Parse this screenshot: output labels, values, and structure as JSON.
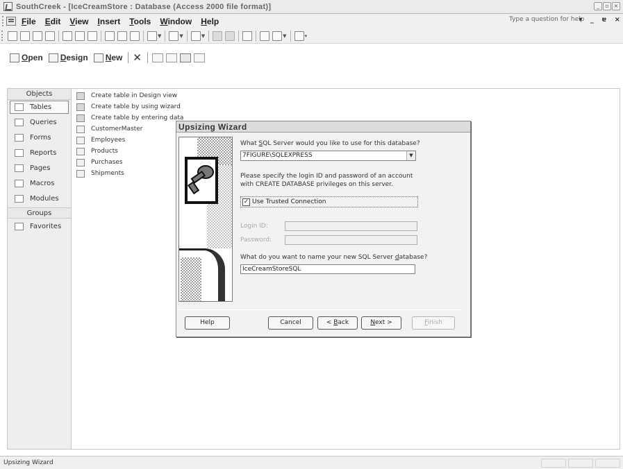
{
  "window": {
    "title": "SouthCreek - [IceCreamStore : Database (Access 2000 file format)]",
    "controls": [
      "minimize",
      "restore",
      "close"
    ]
  },
  "menubar": {
    "items": [
      {
        "label": "File",
        "accel": "F"
      },
      {
        "label": "Edit",
        "accel": "E"
      },
      {
        "label": "View",
        "accel": "V"
      },
      {
        "label": "Insert",
        "accel": "I"
      },
      {
        "label": "Tools",
        "accel": "T"
      },
      {
        "label": "Window",
        "accel": "W"
      },
      {
        "label": "Help",
        "accel": "H"
      }
    ],
    "help_placeholder": "Type a question for help",
    "doc_controls": "▾ _ ɐ ×"
  },
  "toolbar": {
    "icons": [
      "new-icon",
      "open-icon",
      "save-icon",
      "file-search-icon",
      "print-icon",
      "print-preview-icon",
      "spelling-icon",
      "cut-icon",
      "copy-icon",
      "paste-icon",
      "undo-icon",
      "office-links-icon",
      "analyze-icon",
      "code-icon",
      "script-icon",
      "properties-icon",
      "relationships-icon",
      "new-object-icon",
      "help-icon"
    ]
  },
  "db_toolbar": {
    "open_label": "Open",
    "design_label": "Design",
    "new_label": "New"
  },
  "objects_pane": {
    "header": "Objects",
    "items": [
      {
        "label": "Tables",
        "icon": "table-icon",
        "active": true
      },
      {
        "label": "Queries",
        "icon": "query-icon"
      },
      {
        "label": "Forms",
        "icon": "form-icon"
      },
      {
        "label": "Reports",
        "icon": "report-icon"
      },
      {
        "label": "Pages",
        "icon": "page-icon"
      },
      {
        "label": "Macros",
        "icon": "macro-icon"
      },
      {
        "label": "Modules",
        "icon": "module-icon"
      }
    ],
    "groups_header": "Groups",
    "groups": [
      {
        "label": "Favorites",
        "icon": "favorites-folder-icon"
      }
    ]
  },
  "list": {
    "items": [
      {
        "label": "Create table in Design view",
        "kind": "wizard"
      },
      {
        "label": "Create table by using wizard",
        "kind": "wizard"
      },
      {
        "label": "Create table by entering data",
        "kind": "wizard"
      },
      {
        "label": "CustomerMaster",
        "kind": "table"
      },
      {
        "label": "Employees",
        "kind": "table"
      },
      {
        "label": "Products",
        "kind": "table"
      },
      {
        "label": "Purchases",
        "kind": "table"
      },
      {
        "label": "Shipments",
        "kind": "table"
      }
    ]
  },
  "dialog": {
    "title": "Upsizing Wizard",
    "server_question_pre": "What ",
    "server_question_ul": "S",
    "server_question_post": "QL Server would you like to use for this database?",
    "server_value": "7FIGURE\\SQLEXPRESS",
    "login_info_line1": "Please specify the login ID and password of an account",
    "login_info_line2": "with CREATE DATABASE privileges on this server.",
    "trusted_ul": "U",
    "trusted_rest": "se Trusted Connection",
    "trusted_checked": "✓",
    "login_id_label": "Login ID:",
    "password_label": "Password:",
    "login_id_value": "",
    "password_value": "",
    "dbname_question_pre": "What do you want to name your new SQL Server ",
    "dbname_question_ul": "d",
    "dbname_question_post": "atabase?",
    "dbname_value": "IceCreamStoreSQL",
    "buttons": {
      "help": "Help",
      "cancel": "Cancel",
      "back_pre": "< ",
      "back_ul": "B",
      "back_post": "ack",
      "next_ul": "N",
      "next_post": "ext >",
      "finish_ul": "F",
      "finish_post": "inish"
    }
  },
  "statusbar": {
    "text": "Upsizing Wizard"
  }
}
